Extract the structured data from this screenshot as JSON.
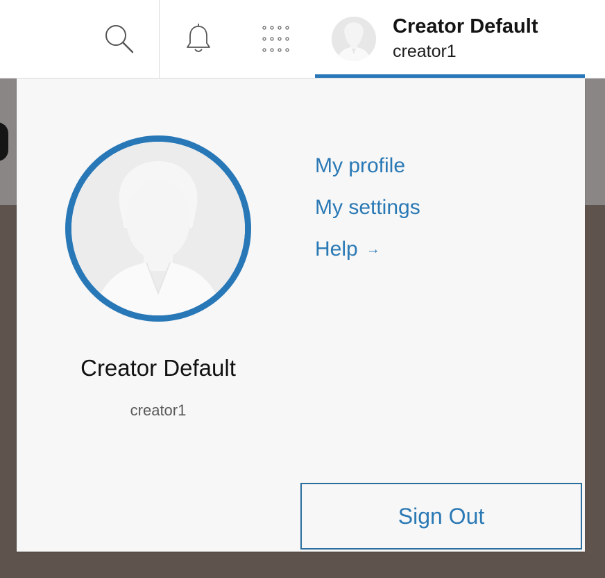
{
  "header": {
    "user": {
      "name": "Creator Default",
      "username": "creator1"
    },
    "icons": [
      "search-icon",
      "bell-icon",
      "apps-grid-icon",
      "avatar"
    ]
  },
  "dropdown": {
    "name": "Creator Default",
    "username": "creator1",
    "menu": [
      {
        "label": "My profile"
      },
      {
        "label": "My settings"
      },
      {
        "label": "Help",
        "arrow": "→"
      }
    ],
    "sign_out_label": "Sign Out"
  },
  "colors": {
    "accent": "#2878b8",
    "link": "#2a79b5"
  }
}
